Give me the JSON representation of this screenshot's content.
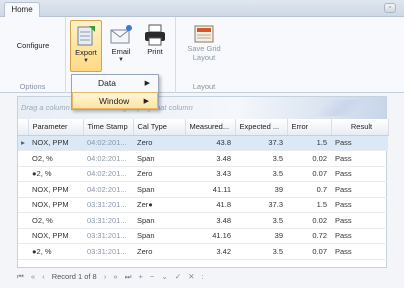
{
  "tabs": [
    {
      "label": "Home"
    }
  ],
  "ribbon": {
    "groups": [
      {
        "label": "Options",
        "buttons": [
          {
            "label": "Configure"
          }
        ]
      },
      {
        "label": "",
        "buttons": [
          {
            "label": "Export"
          },
          {
            "label": "Email"
          },
          {
            "label": "Print"
          }
        ]
      },
      {
        "label": "Layout",
        "buttons": [
          {
            "label": "Save Grid\nLayout"
          }
        ]
      }
    ]
  },
  "dropdown": {
    "items": [
      {
        "label": "Data"
      },
      {
        "label": "Window"
      }
    ]
  },
  "grid": {
    "groupbar_text": "Drag a column header here to group by that column",
    "columns": [
      "Parameter",
      "Time Stamp",
      "Cal Type",
      "Measured...",
      "Expected ...",
      "Error",
      "Result"
    ],
    "rows": [
      {
        "parameter": "NOX, PPM",
        "timestamp": "04:02:201...",
        "caltype": "Zero",
        "measured": "43.8",
        "expected": "37.3",
        "error": "1.5",
        "result": "Pass"
      },
      {
        "parameter": "O2, %",
        "timestamp": "04:02:201...",
        "caltype": "Span",
        "measured": "3.48",
        "expected": "3.5",
        "error": "0.02",
        "result": "Pass"
      },
      {
        "parameter": "●2, %",
        "timestamp": "04:02:201...",
        "caltype": "Zero",
        "measured": "3.43",
        "expected": "3.5",
        "error": "0.07",
        "result": "Pass"
      },
      {
        "parameter": "NOX, PPM",
        "timestamp": "04:02:201...",
        "caltype": "Span",
        "measured": "41.11",
        "expected": "39",
        "error": "0.7",
        "result": "Pass"
      },
      {
        "parameter": "NOX, PPM",
        "timestamp": "03:31:201...",
        "caltype": "Zer●",
        "measured": "41.8",
        "expected": "37.3",
        "error": "1.5",
        "result": "Pass"
      },
      {
        "parameter": "O2, %",
        "timestamp": "03:31:201...",
        "caltype": "Span",
        "measured": "3.48",
        "expected": "3.5",
        "error": "0.02",
        "result": "Pass"
      },
      {
        "parameter": "NOX, PPM",
        "timestamp": "03:31:201...",
        "caltype": "Span",
        "measured": "41.16",
        "expected": "39",
        "error": "0.72",
        "result": "Pass"
      },
      {
        "parameter": "●2, %",
        "timestamp": "03:31:201...",
        "caltype": "Zero",
        "measured": "3.42",
        "expected": "3.5",
        "error": "0.07",
        "result": "Pass"
      }
    ]
  },
  "navigator": {
    "first": "⏮",
    "prev_page": "«",
    "prev": "‹",
    "record_text": "Record 1 of 8",
    "next": "›",
    "next_page": "»",
    "last": "⏭",
    "add": "+",
    "delete": "−",
    "edit": "⌄",
    "apply": "✓",
    "cancel": "✕",
    "extra": ":"
  }
}
